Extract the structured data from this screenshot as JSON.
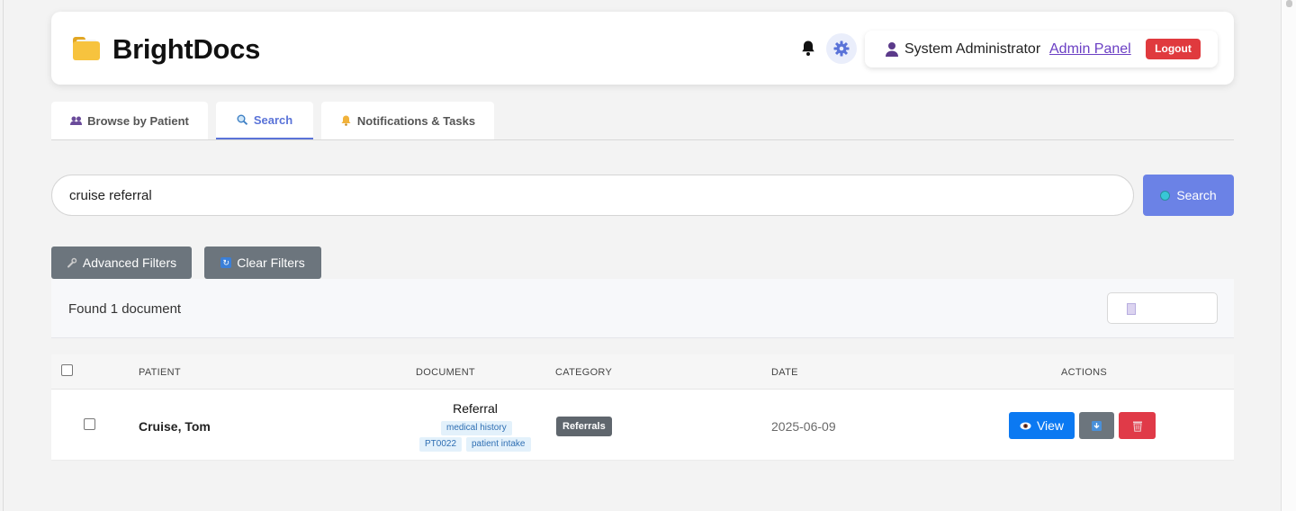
{
  "app": {
    "brand": "BrightDocs",
    "colors": {
      "accent": "#6b82e6",
      "danger": "#e03a3e",
      "primary": "#0b79f2",
      "secondary": "#6c757d"
    }
  },
  "header": {
    "user_name": "System Administrator",
    "admin_link": "Admin Panel",
    "logout": "Logout",
    "icons": [
      "folder-icon",
      "bell-icon",
      "gear-icon",
      "user-icon"
    ]
  },
  "tabs": [
    {
      "label": "Browse by Patient",
      "icon": "people-icon",
      "active": false
    },
    {
      "label": "Search",
      "icon": "magnifier-icon",
      "active": true
    },
    {
      "label": "Notifications & Tasks",
      "icon": "bell-icon",
      "active": false
    }
  ],
  "search": {
    "value": "cruise referral",
    "button_label": "Search"
  },
  "filters": {
    "advanced": "Advanced Filters",
    "clear": "Clear Filters"
  },
  "results": {
    "summary": "Found 1 document",
    "columns": [
      "PATIENT",
      "DOCUMENT",
      "CATEGORY",
      "DATE",
      "ACTIONS"
    ],
    "rows": [
      {
        "patient": "Cruise, Tom",
        "document": "Referral",
        "tags": [
          "medical history",
          "PT0022",
          "patient intake"
        ],
        "category": "Referrals",
        "date": "2025-06-09",
        "view_label": "View"
      }
    ]
  }
}
